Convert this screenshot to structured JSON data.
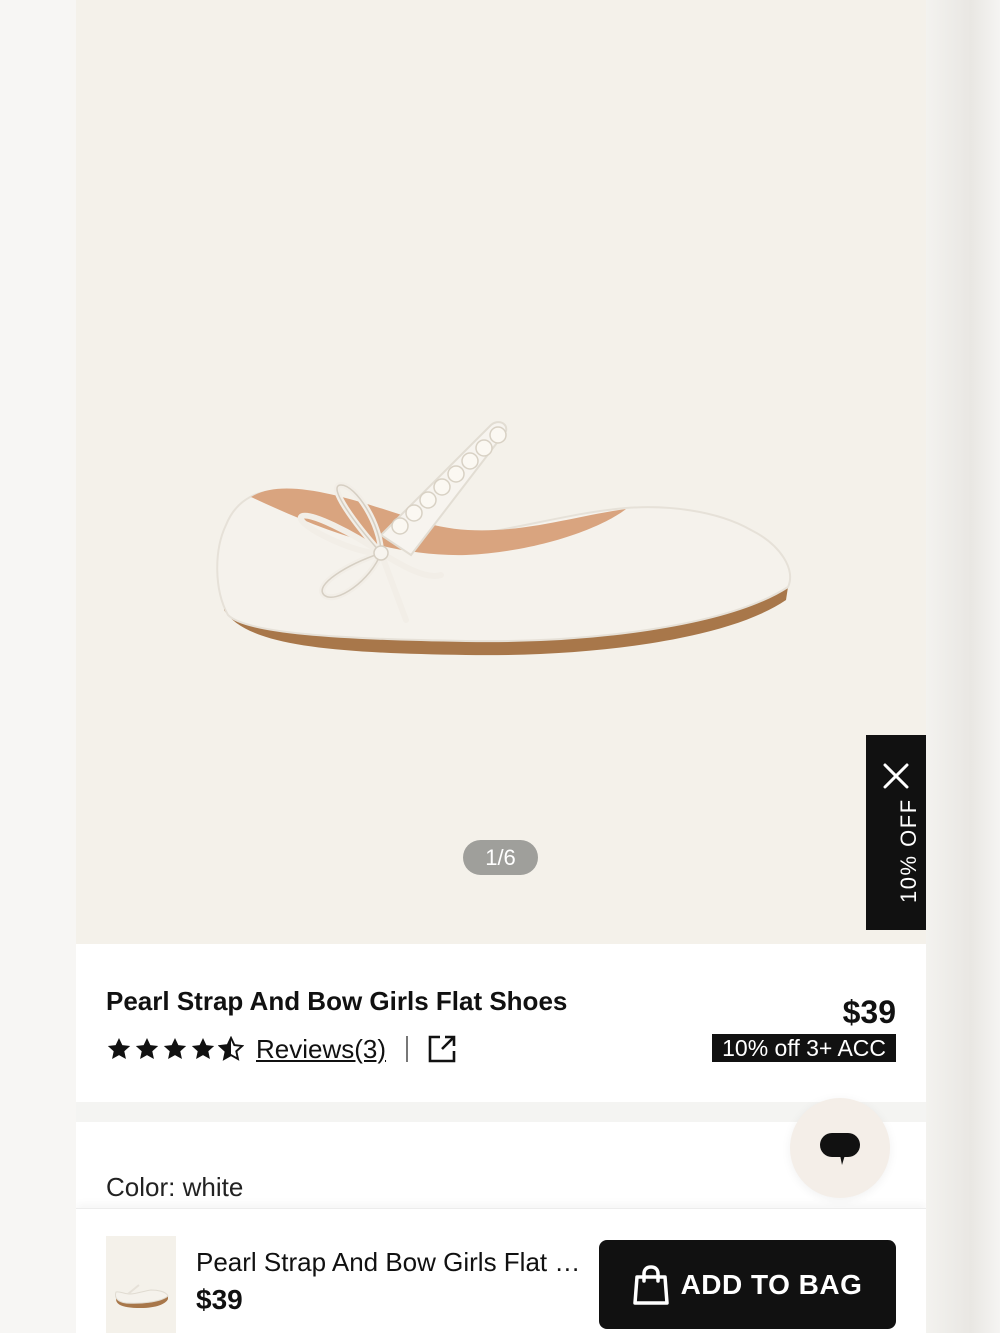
{
  "gallery": {
    "counter": "1/6"
  },
  "promo": {
    "label": "10% OFF"
  },
  "product": {
    "title": "Pearl Strap And Bow Girls Flat Shoes",
    "rating": 4.5,
    "reviews_label": "Reviews(3)",
    "price": "$39",
    "deal": "10% off 3+ ACC"
  },
  "color": {
    "label": "Color: white"
  },
  "bottom_bar": {
    "title": "Pearl Strap And Bow Girls Flat Shoes",
    "price": "$39",
    "add_label": "ADD TO BAG"
  },
  "colors": {
    "accent": "#111111",
    "hero_bg": "#f4f1ea"
  },
  "icons": [
    "close-icon",
    "star-icon",
    "share-icon",
    "chat-icon",
    "shopping-bag-icon"
  ]
}
